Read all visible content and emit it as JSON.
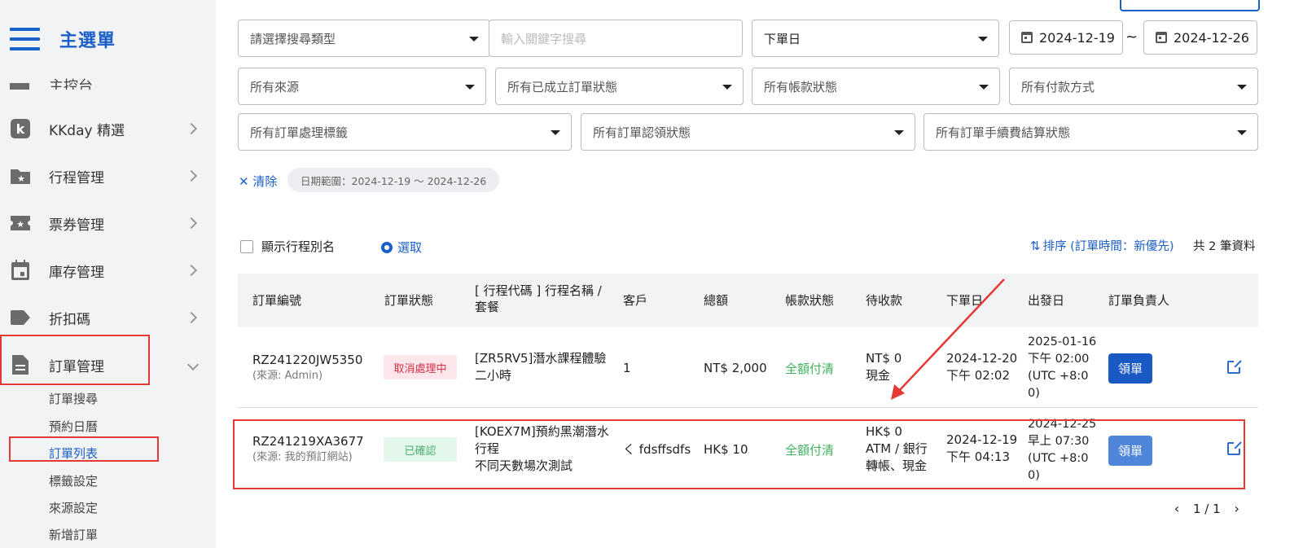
{
  "sidebar": {
    "menu_icon": "hamburger-icon",
    "title": "主選單",
    "partial_item": "主控台",
    "items": [
      {
        "label": "KKday 精選",
        "icon": "kkday-logo-icon"
      },
      {
        "label": "行程管理",
        "icon": "folder-star-icon"
      },
      {
        "label": "票券管理",
        "icon": "ticket-star-icon"
      },
      {
        "label": "庫存管理",
        "icon": "calendar-icon"
      },
      {
        "label": "折扣碼",
        "icon": "tag-icon"
      },
      {
        "label": "訂單管理",
        "icon": "document-icon"
      }
    ],
    "sub_items": [
      "訂單搜尋",
      "預約日曆",
      "訂單列表",
      "標籤設定",
      "來源設定",
      "新增訂單"
    ],
    "active_sub_item": "訂單列表"
  },
  "filters": {
    "search_type_placeholder": "請選擇搜尋類型",
    "keyword_placeholder": "輸入關鍵字搜尋",
    "date_type": "下單日",
    "date_from": "2024-12-19",
    "date_sep": "~",
    "date_to": "2024-12-26",
    "source": "所有來源",
    "order_status": "所有已成立訂單狀態",
    "account_status": "所有帳款狀態",
    "payment_method": "所有付款方式",
    "processing_tag": "所有訂單處理標籤",
    "claim_status": "所有訂單認領狀態",
    "fee_status": "所有訂單手續費結算狀態"
  },
  "filter_bar": {
    "clear_label": "✕ 清除",
    "chip": "日期範圍：2024-12-19 ～ 2024-12-26"
  },
  "toolbar": {
    "show_alias_label": "顯示行程別名",
    "select_label": "選取",
    "sort_label": "排序 (訂單時間：新優先)",
    "total_label": "共 2 筆資料"
  },
  "table": {
    "headers": {
      "order_no": "訂單編號",
      "status": "訂單狀態",
      "product": "[ 行程代碼 ] 行程名稱 /",
      "product2": "套餐",
      "customer": "客戶",
      "total": "總額",
      "account": "帳款狀態",
      "receivable": "待收款",
      "order_date": "下單日",
      "departure": "出發日",
      "owner": "訂單負責人"
    },
    "rows": [
      {
        "order_no": "RZ241220JW5350",
        "source": "(來源: Admin)",
        "status": "取消處理中",
        "product_line1": "[ZR5RV5]潛水課程體驗",
        "product_line2": "二小時",
        "product_line3": "",
        "customer": "1",
        "total": "NT$ 2,000",
        "account": "全額付清",
        "receivable_line1": "NT$ 0",
        "receivable_line2": "現金",
        "receivable_line3": "",
        "order_date_line1": "2024-12-20",
        "order_date_line2": "下午 02:02",
        "departure_line1": "2025-01-16",
        "departure_line2": "下午 02:00",
        "departure_line3": "(UTC +8:0",
        "departure_line4": "0)",
        "claim_label": "領單"
      },
      {
        "order_no": "RZ241219XA3677",
        "source": "(來源: 我的預訂網站)",
        "status": "已確認",
        "product_line1": "[KOEX7M]預約黑潮潛水",
        "product_line2": "行程",
        "product_line3": "不同天數場次測試",
        "customer": "く fdsffsdfs",
        "total": "HK$ 10",
        "account": "全額付清",
        "receivable_line1": "HK$ 0",
        "receivable_line2": "ATM / 銀行",
        "receivable_line3": "轉帳、現金",
        "order_date_line1": "2024-12-19",
        "order_date_line2": "下午 04:13",
        "departure_line1": "2024-12-25",
        "departure_line2": "早上 07:30",
        "departure_line3": "(UTC +8:0",
        "departure_line4": "0)",
        "claim_label": "領單"
      }
    ]
  },
  "pagination": {
    "prev_icon": "chevron-left-icon",
    "next_icon": "chevron-right-icon",
    "text": "1 / 1"
  },
  "colors": {
    "accent": "#1b5fc8",
    "annotation_red": "#e53935",
    "paid_green": "#43b35f"
  }
}
